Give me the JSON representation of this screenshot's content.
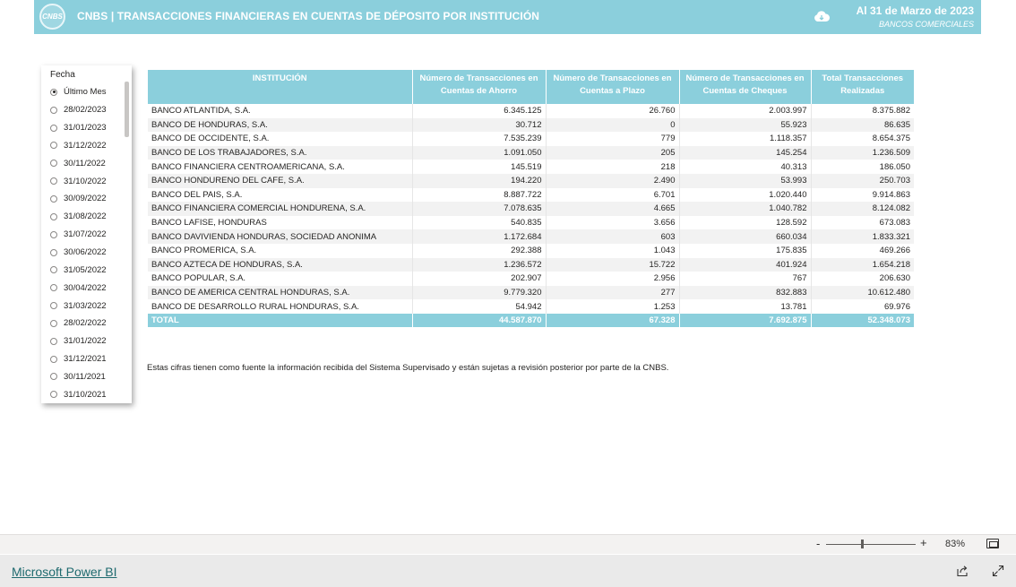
{
  "header": {
    "logo_text": "CNBS",
    "title": "CNBS | TRANSACCIONES FINANCIERAS EN CUENTAS DE DÉPOSITO POR INSTITUCIÓN",
    "date": "Al 31 de Marzo de 2023",
    "subtitle": "BANCOS COMERCIALES",
    "cloud_icon": "cloud-download-icon"
  },
  "slicer": {
    "title": "Fecha",
    "selected": "Último Mes",
    "items": [
      "Último Mes",
      "28/02/2023",
      "31/01/2023",
      "31/12/2022",
      "30/11/2022",
      "31/10/2022",
      "30/09/2022",
      "31/08/2022",
      "31/07/2022",
      "30/06/2022",
      "31/05/2022",
      "30/04/2022",
      "31/03/2022",
      "28/02/2022",
      "31/01/2022",
      "31/12/2021",
      "30/11/2021",
      "31/10/2021"
    ]
  },
  "table": {
    "headers": [
      "INSTITUCIÓN",
      "Número de Transacciones en Cuentas de Ahorro",
      "Número de Transacciones en Cuentas a Plazo",
      "Número de Transacciones en Cuentas de Cheques",
      "Total Transacciones Realizadas"
    ],
    "rows": [
      [
        "BANCO ATLANTIDA, S.A.",
        "6.345.125",
        "26.760",
        "2.003.997",
        "8.375.882"
      ],
      [
        "BANCO DE HONDURAS, S.A.",
        "30.712",
        "0",
        "55.923",
        "86.635"
      ],
      [
        "BANCO DE OCCIDENTE, S.A.",
        "7.535.239",
        "779",
        "1.118.357",
        "8.654.375"
      ],
      [
        "BANCO DE LOS TRABAJADORES, S.A.",
        "1.091.050",
        "205",
        "145.254",
        "1.236.509"
      ],
      [
        "BANCO FINANCIERA CENTROAMERICANA, S.A.",
        "145.519",
        "218",
        "40.313",
        "186.050"
      ],
      [
        "BANCO HONDURENO DEL CAFE, S.A.",
        "194.220",
        "2.490",
        "53.993",
        "250.703"
      ],
      [
        "BANCO DEL PAIS, S.A.",
        "8.887.722",
        "6.701",
        "1.020.440",
        "9.914.863"
      ],
      [
        "BANCO FINANCIERA COMERCIAL HONDURENA, S.A.",
        "7.078.635",
        "4.665",
        "1.040.782",
        "8.124.082"
      ],
      [
        "BANCO LAFISE, HONDURAS",
        "540.835",
        "3.656",
        "128.592",
        "673.083"
      ],
      [
        "BANCO DAVIVIENDA HONDURAS, SOCIEDAD ANONIMA",
        "1.172.684",
        "603",
        "660.034",
        "1.833.321"
      ],
      [
        "BANCO PROMERICA, S.A.",
        "292.388",
        "1.043",
        "175.835",
        "469.266"
      ],
      [
        "BANCO AZTECA DE HONDURAS, S.A.",
        "1.236.572",
        "15.722",
        "401.924",
        "1.654.218"
      ],
      [
        "BANCO POPULAR, S.A.",
        "202.907",
        "2.956",
        "767",
        "206.630"
      ],
      [
        "BANCO DE AMERICA CENTRAL HONDURAS, S.A.",
        "9.779.320",
        "277",
        "832.883",
        "10.612.480"
      ],
      [
        "BANCO DE DESARROLLO RURAL HONDURAS, S.A.",
        "54.942",
        "1.253",
        "13.781",
        "69.976"
      ]
    ],
    "total": [
      "TOTAL",
      "44.587.870",
      "67.328",
      "7.692.875",
      "52.348.073"
    ]
  },
  "note": "Estas cifras tienen como fuente la información recibida del Sistema Supervisado y están sujetas a revisión posterior por parte de la CNBS.",
  "zoom": {
    "minus": "-",
    "plus": "+",
    "percent": "83%"
  },
  "footer": {
    "link": "Microsoft Power BI"
  },
  "colors": {
    "accent": "#8bcfdc",
    "stripe": "#f2f2f2"
  }
}
